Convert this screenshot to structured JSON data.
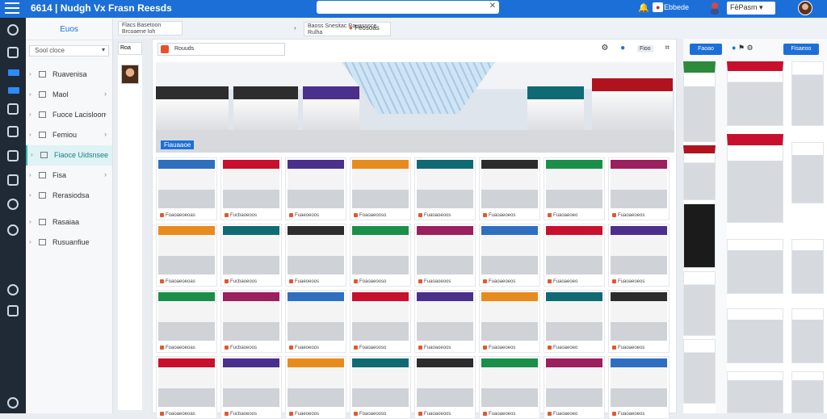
{
  "app": {
    "title": "6614 | Nudgh Vх Frasn Reesds"
  },
  "topbar": {
    "search_clear_icon": "close-icon",
    "notification_icon": "bell-icon",
    "user_chip": "Ebbede",
    "dropdown_label": "FēPasm",
    "accent": "#1d6fd8"
  },
  "sidebar": {
    "header": "Euos",
    "select_label": "Sool cloce",
    "items": [
      {
        "label": "Ruavenisa",
        "icon": "folder-icon"
      },
      {
        "label": "Maol",
        "icon": "mail-icon"
      },
      {
        "label": "Fuoce Lacisloon",
        "icon": "location-icon"
      },
      {
        "label": "Femiou",
        "icon": "grid-icon"
      },
      {
        "label": "Fiaoce Uidsnsee",
        "icon": "store-icon",
        "active": true
      },
      {
        "label": "Fisa",
        "icon": "file-icon"
      },
      {
        "label": "Rerasiodsa",
        "icon": "settings-icon"
      },
      {
        "label": "Rasaiaa",
        "icon": "user-icon"
      },
      {
        "label": "Rusuanfiue",
        "icon": "image-icon"
      }
    ]
  },
  "breadcrumb": {
    "first": "Flacs Basetoon Brcoaene loh",
    "second": "Baoss Snesitac Rauasnsce Rulha",
    "third": "Feosoas"
  },
  "left_strip": {
    "tab": "Roa"
  },
  "main": {
    "search": "Rouuds",
    "tools_pill": "Fioo",
    "hero_label": "Fiauaaoe"
  },
  "cards": [
    "Foaoaeoeoas",
    "Fucbaoeoos",
    "Fuaeoeoos",
    "Foaoaeooso",
    "Fuaoaoeoos",
    "Fuaoaeoeos",
    "Fuaoaeoeo",
    "Fuaoaeoeos",
    "Foaoaeoeoas",
    "Fucbaoeoos",
    "Fuaeoeoos",
    "Foaoaeooso",
    "Fuaoaoeoos",
    "Fuaoaeoeos",
    "Fuaoaeoeo",
    "Fuaoaeoeos",
    "Foaoaeoeoas",
    "Fucbaoeoos",
    "Fuaeoeoos",
    "Foaoaeooso",
    "Fuaoaoeoos",
    "Fuaoaeoeos",
    "Fuaoaeoeo",
    "Fuaoaeoeos",
    "Foaoaeoeoas",
    "Fucbaoeoos",
    "Fuaeoeoos",
    "Foaoaeooso",
    "Fuaoaoeoos",
    "Fuaoaeoeos",
    "Fuaoaeoeo",
    "Fuaoaeoeos"
  ],
  "right_panel": {
    "button1": "Faoao",
    "button2": "Fisaeoo"
  }
}
